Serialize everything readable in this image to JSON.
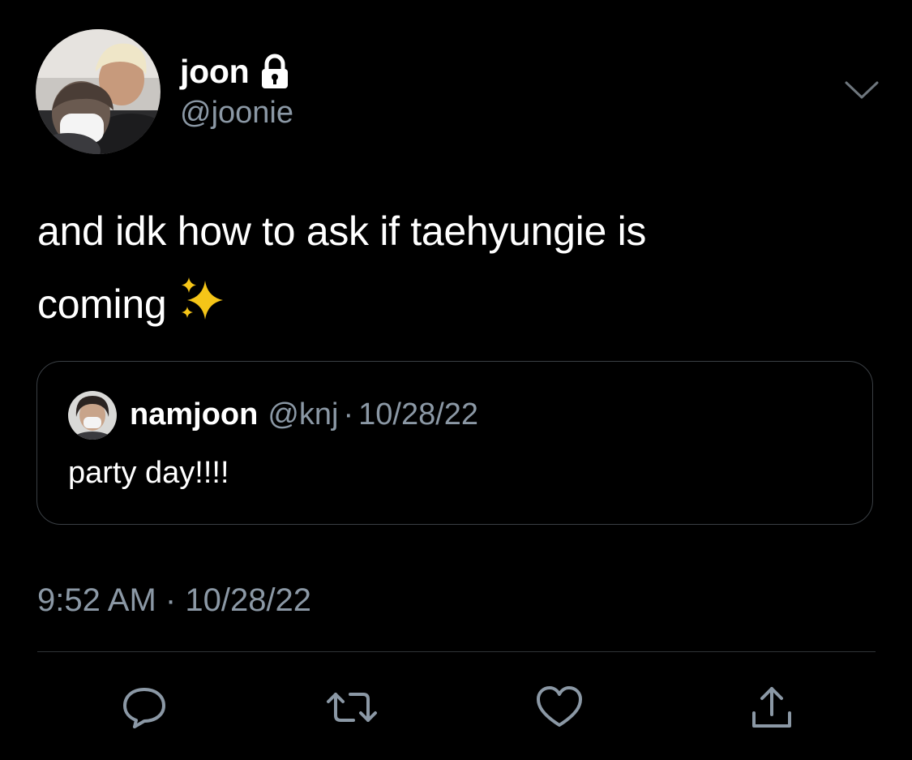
{
  "author": {
    "display_name": "joon",
    "handle": "@joonie",
    "protected_icon": "lock-icon"
  },
  "tweet": {
    "text_line1": "and idk how to ask if taehyungie is",
    "text_line2": "coming",
    "emoji": "sparkles-icon"
  },
  "quoted_tweet": {
    "display_name": "namjoon",
    "handle": "@knj",
    "separator": "·",
    "date": "10/28/22",
    "text": "party day!!!!"
  },
  "meta": {
    "time": "9:52 AM",
    "separator": "·",
    "date": "10/28/22"
  },
  "actions": [
    {
      "icon": "reply-icon"
    },
    {
      "icon": "retweet-icon"
    },
    {
      "icon": "like-icon"
    },
    {
      "icon": "share-icon"
    }
  ],
  "colors": {
    "background": "#000000",
    "primary_text": "#ffffff",
    "secondary_text": "#8b98a5",
    "border": "#2f3336",
    "sparkle": "#f5c518"
  }
}
